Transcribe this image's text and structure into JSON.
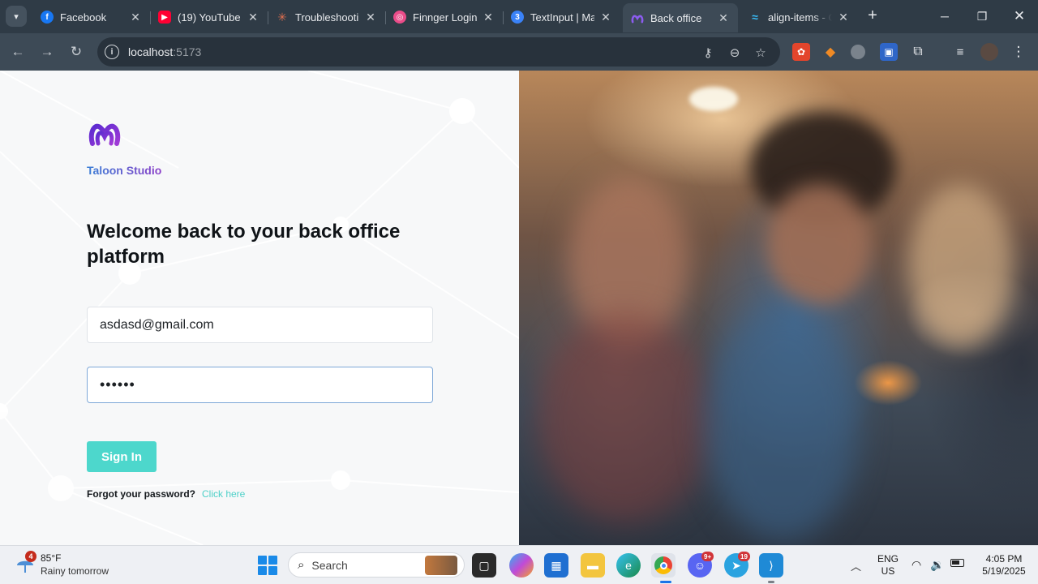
{
  "browser": {
    "tabs": [
      {
        "title": "Facebook",
        "icon": "facebook-icon",
        "color": "#1877f2"
      },
      {
        "title": "(19) YouTube",
        "icon": "youtube-icon",
        "color": "#ff0033"
      },
      {
        "title": "Troubleshootin",
        "icon": "sunburst-icon",
        "color": "#e07050"
      },
      {
        "title": "Finnger Login",
        "icon": "dribbble-icon",
        "color": "#ea4c89"
      },
      {
        "title": "TextInput | Ma",
        "icon": "material-icon",
        "color": "#3a82f7"
      },
      {
        "title": "Back office",
        "icon": "taloon-icon",
        "color": "#7b3fd6"
      },
      {
        "title": "align-items - C",
        "icon": "tailwind-icon",
        "color": "#38bdf8"
      }
    ],
    "url": {
      "host": "localhost",
      "port": ":5173"
    }
  },
  "app": {
    "brand": "Taloon Studio",
    "heading": "Welcome back to your back office platform",
    "email_value": "asdasd@gmail.com",
    "password_value": "••••••",
    "signin_label": "Sign In",
    "forgot_label": "Forgot your password?",
    "click_here_label": "Click here",
    "accent_color": "#4dd7cc"
  },
  "taskbar": {
    "weather_badge": "4",
    "temperature": "85°F",
    "weather_desc": "Rainy tomorrow",
    "search_label": "Search",
    "discord_badge": "9+",
    "telegram_badge": "19",
    "lang_primary": "ENG",
    "lang_secondary": "US",
    "time": "4:05 PM",
    "date": "5/19/2025"
  }
}
